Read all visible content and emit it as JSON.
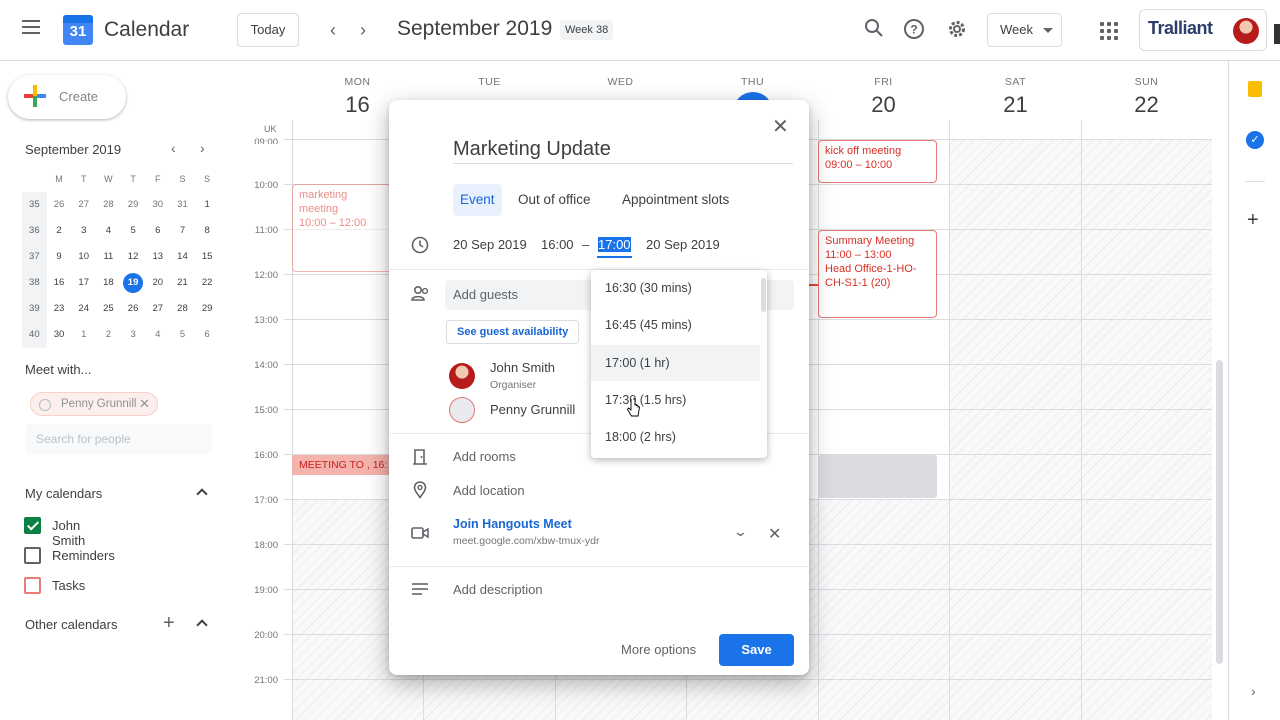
{
  "header": {
    "app_title": "Calendar",
    "logo_day": "31",
    "today_label": "Today",
    "month_title": "September 2019",
    "week_badge": "Week 38",
    "view_label": "Week",
    "brand": "Tralliant"
  },
  "sidebar": {
    "create_label": "Create",
    "mini_cal": {
      "title": "September 2019",
      "dow": [
        "M",
        "T",
        "W",
        "T",
        "F",
        "S",
        "S"
      ],
      "rows": [
        {
          "wk": "35",
          "days": [
            "26",
            "27",
            "28",
            "29",
            "30",
            "31",
            "1"
          ]
        },
        {
          "wk": "36",
          "days": [
            "2",
            "3",
            "4",
            "5",
            "6",
            "7",
            "8"
          ]
        },
        {
          "wk": "37",
          "days": [
            "9",
            "10",
            "11",
            "12",
            "13",
            "14",
            "15"
          ]
        },
        {
          "wk": "38",
          "days": [
            "16",
            "17",
            "18",
            "19",
            "20",
            "21",
            "22"
          ]
        },
        {
          "wk": "39",
          "days": [
            "23",
            "24",
            "25",
            "26",
            "27",
            "28",
            "29"
          ]
        },
        {
          "wk": "40",
          "days": [
            "30",
            "1",
            "2",
            "3",
            "4",
            "5",
            "6"
          ]
        }
      ]
    },
    "meet_with": "Meet with...",
    "chip_label": "Penny Grunnill",
    "search_people_placeholder": "Search for people",
    "my_calendars_title": "My calendars",
    "calendars": [
      {
        "label": "John Smith"
      },
      {
        "label": "Reminders"
      },
      {
        "label": "Tasks"
      }
    ],
    "other_calendars_title": "Other calendars"
  },
  "week": {
    "tz": "UK",
    "days": [
      {
        "dow": "MON",
        "num": "16"
      },
      {
        "dow": "TUE",
        "num": ""
      },
      {
        "dow": "WED",
        "num": ""
      },
      {
        "dow": "THU",
        "num": ""
      },
      {
        "dow": "FRI",
        "num": "20"
      },
      {
        "dow": "SAT",
        "num": "21"
      },
      {
        "dow": "SUN",
        "num": "22"
      }
    ],
    "hours": [
      "09:00",
      "10:00",
      "11:00",
      "12:00",
      "13:00",
      "14:00",
      "15:00",
      "16:00",
      "17:00",
      "18:00",
      "19:00",
      "20:00",
      "21:00"
    ],
    "events": {
      "marketing_title": "marketing meeting",
      "marketing_time": "10:00 – 12:00",
      "meeting_to": "MEETING TO , 16:",
      "kickoff_title": "kick off meeting",
      "kickoff_time": "09:00 – 10:00",
      "summary_title": "Summary Meeting",
      "summary_time": "11:00 – 13:00",
      "summary_loc": "Head Office-1-HO-CH-S1-1 (20)"
    }
  },
  "dialog": {
    "title": "Marketing Update",
    "tabs": [
      "Event",
      "Out of office",
      "Appointment slots"
    ],
    "start_date": "20 Sep 2019",
    "start_time": "16:00",
    "dash": "–",
    "end_time": "17:00",
    "end_date": "20 Sep 2019",
    "guests_placeholder": "Add guests",
    "guest_availability": "See guest availability",
    "guests": [
      {
        "name": "John Smith",
        "role": "Organiser"
      },
      {
        "name": "Penny Grunnill",
        "role": ""
      }
    ],
    "rooms_label": "Add rooms",
    "location_label": "Add location",
    "meet_link": "Join Hangouts Meet",
    "meet_url": "meet.google.com/xbw-tmux-ydr",
    "description_label": "Add description",
    "more_options": "More options",
    "save": "Save"
  },
  "time_dropdown": {
    "options": [
      "16:30 (30 mins)",
      "16:45 (45 mins)",
      "17:00 (1 hr)",
      "17:30 (1.5 hrs)",
      "18:00 (2 hrs)"
    ]
  }
}
